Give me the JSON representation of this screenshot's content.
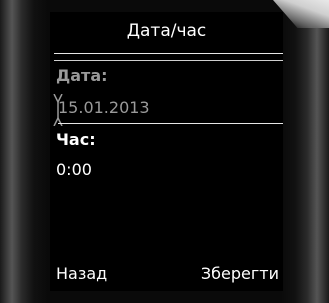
{
  "screen": {
    "title": "Дата/час",
    "date": {
      "label": "Дата:",
      "value": "15.01.2013"
    },
    "time": {
      "label": "Час:",
      "value": "0:00"
    }
  },
  "softkeys": {
    "left_label": "Назад",
    "right_label": "Зберегти"
  },
  "colors": {
    "background": "#000000",
    "active_text": "#ffffff",
    "inactive_text": "#9a9a9a"
  },
  "icons": {
    "edit_cursor": "text-cursor-icon"
  }
}
